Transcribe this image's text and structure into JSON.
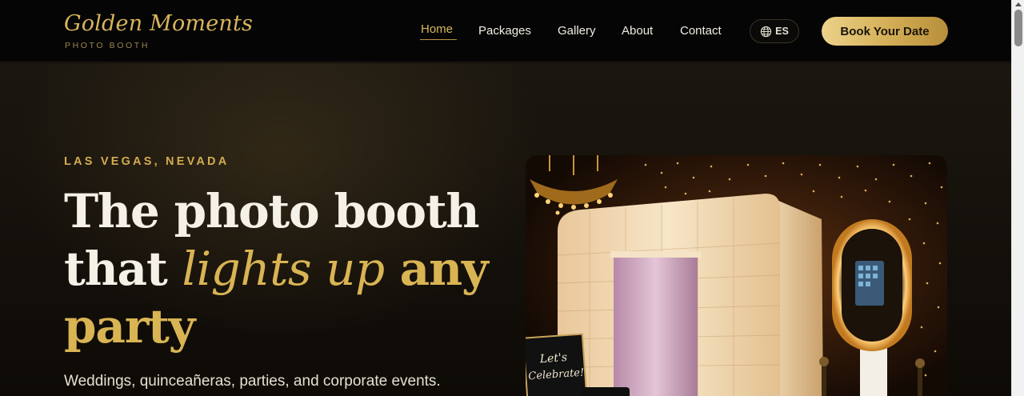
{
  "brand": {
    "title": "Golden Moments",
    "subtitle": "PHOTO BOOTH"
  },
  "nav": {
    "items": [
      "Home",
      "Packages",
      "Gallery",
      "About",
      "Contact"
    ],
    "active": "Home"
  },
  "language": {
    "label": "ES",
    "icon": "globe-icon"
  },
  "cta": {
    "label": "Book Your Date"
  },
  "hero": {
    "eyebrow": "LAS VEGAS, NEVADA",
    "headline_line1": "The photo booth",
    "headline_that": "that",
    "headline_script": "lights up",
    "headline_any": "any",
    "headline_party": "party",
    "tagline": "Weddings, quinceañeras, parties, and corporate events.",
    "image": {
      "subject": "inflatable LED photo booth with chandelier and ring-light kiosk",
      "sign_line1": "Let's",
      "sign_line2": "Celebrate!"
    }
  },
  "colors": {
    "gold": "#d9b453",
    "background": "#0f0c08",
    "header": "#050505",
    "text": "#f6f1e7"
  }
}
